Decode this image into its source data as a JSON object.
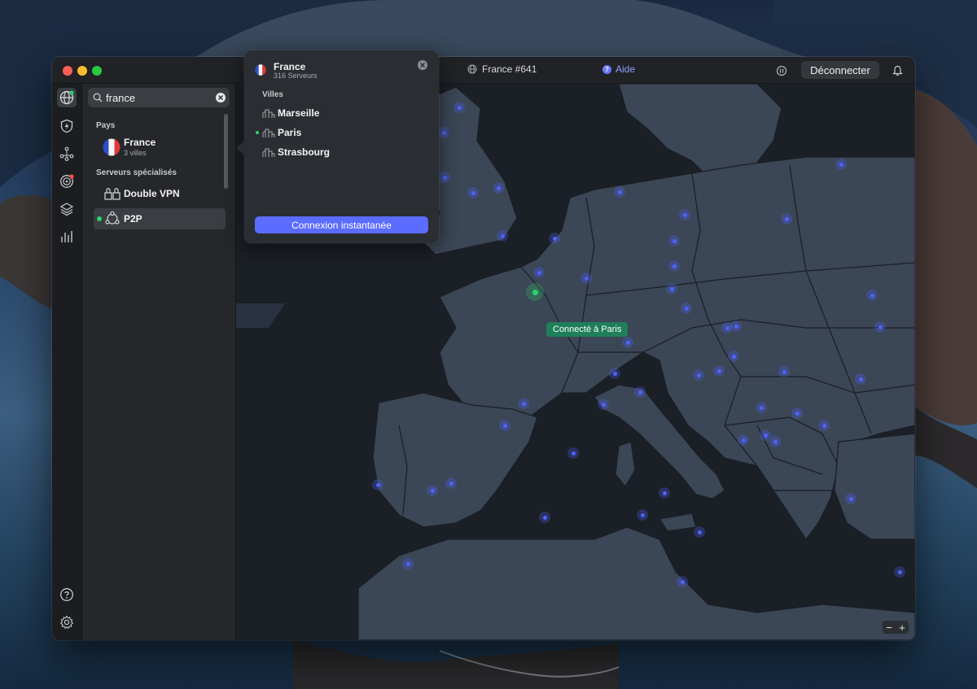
{
  "titlebar": {
    "server_label": "France #641",
    "help_label": "Aide",
    "disconnect_label": "Déconnecter"
  },
  "search": {
    "value": "france"
  },
  "sidebar": {
    "countries_heading": "Pays",
    "country_name": "France",
    "country_sub": "3 villes",
    "specialty_heading": "Serveurs spécialisés",
    "double_vpn_label": "Double VPN",
    "p2p_label": "P2P"
  },
  "popup": {
    "country": "France",
    "servers": "316 Serveurs",
    "cities_heading": "Villes",
    "cities": [
      "Marseille",
      "Paris",
      "Strasbourg"
    ],
    "cta_label": "Connexion instantanée"
  },
  "map": {
    "connected_label": "Connecté à Paris"
  },
  "zoom": {
    "out": "−",
    "in": "+"
  },
  "colors": {
    "accent": "#5b6cff",
    "connected": "#1e7f5a",
    "server_dot": "#4f63ff",
    "status_green": "#2bd46a",
    "notice_red": "#ff4d4d"
  }
}
